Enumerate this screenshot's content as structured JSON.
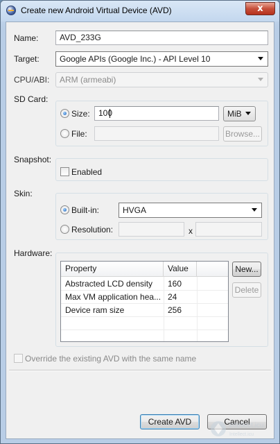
{
  "window": {
    "title": "Create new Android Virtual Device (AVD)",
    "close_label": "x"
  },
  "name": {
    "label": "Name:",
    "value": "AVD_233G"
  },
  "target": {
    "label": "Target:",
    "value": "Google APIs (Google Inc.) - API Level 10"
  },
  "cpu": {
    "label": "CPU/ABI:",
    "value": "ARM (armeabi)"
  },
  "sdcard": {
    "label": "SD Card:",
    "size_label": "Size:",
    "size_value": "100",
    "unit": "MiB",
    "file_label": "File:",
    "file_value": "",
    "browse_label": "Browse..."
  },
  "snapshot": {
    "label": "Snapshot:",
    "enabled_label": "Enabled"
  },
  "skin": {
    "label": "Skin:",
    "builtin_label": "Built-in:",
    "builtin_value": "HVGA",
    "resolution_label": "Resolution:",
    "res_width": "",
    "res_x": "x",
    "res_height": ""
  },
  "hardware": {
    "label": "Hardware:",
    "columns": [
      "Property",
      "Value"
    ],
    "rows": [
      {
        "property": "Abstracted LCD density",
        "value": "160"
      },
      {
        "property": "Max VM application hea...",
        "value": "24"
      },
      {
        "property": "Device ram size",
        "value": "256"
      }
    ],
    "new_label": "New...",
    "delete_label": "Delete"
  },
  "override_label": "Override the existing AVD with the same name",
  "buttons": {
    "create_label": "Create AVD",
    "cancel_label": "Cancel"
  },
  "watermark": {
    "text": "intellect.icu",
    "subtext": "Intellect.icu"
  },
  "colors": {
    "title_bg": "#c9dbef",
    "client_bg": "#f0f0f0",
    "close_red": "#c7503b",
    "accent_blue": "#1e5fb3"
  },
  "icons": [
    "eclipse-app-icon",
    "close-icon",
    "dropdown-arrow-icon",
    "watermark-logo-icon"
  ]
}
